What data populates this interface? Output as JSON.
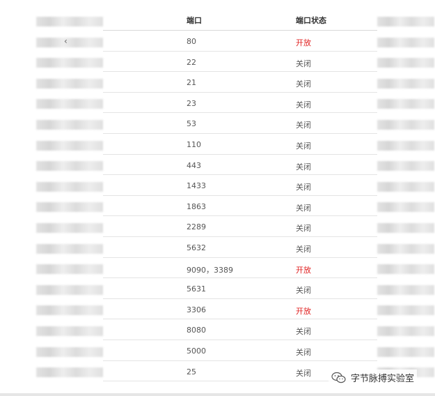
{
  "table": {
    "headers": {
      "port": "端口",
      "status": "端口状态"
    },
    "rows": [
      {
        "port": "80",
        "status": "开放",
        "open": true
      },
      {
        "port": "22",
        "status": "关闭",
        "open": false
      },
      {
        "port": "21",
        "status": "关闭",
        "open": false
      },
      {
        "port": "23",
        "status": "关闭",
        "open": false
      },
      {
        "port": "53",
        "status": "关闭",
        "open": false
      },
      {
        "port": "110",
        "status": "关闭",
        "open": false
      },
      {
        "port": "443",
        "status": "关闭",
        "open": false
      },
      {
        "port": "1433",
        "status": "关闭",
        "open": false
      },
      {
        "port": "1863",
        "status": "关闭",
        "open": false
      },
      {
        "port": "2289",
        "status": "关闭",
        "open": false
      },
      {
        "port": "5632",
        "status": "关闭",
        "open": false
      },
      {
        "port": "9090，3389",
        "status": "开放",
        "open": true
      },
      {
        "port": "5631",
        "status": "关闭",
        "open": false
      },
      {
        "port": "3306",
        "status": "开放",
        "open": true
      },
      {
        "port": "8080",
        "status": "关闭",
        "open": false
      },
      {
        "port": "5000",
        "status": "关闭",
        "open": false
      },
      {
        "port": "25",
        "status": "关闭",
        "open": false
      }
    ]
  },
  "nav": {
    "back_glyph": "‹"
  },
  "watermark": {
    "text": "字节脉搏实验室",
    "icon": "wechat-icon"
  },
  "colors": {
    "open": "#e02020",
    "closed": "#555555",
    "header": "#333333"
  }
}
